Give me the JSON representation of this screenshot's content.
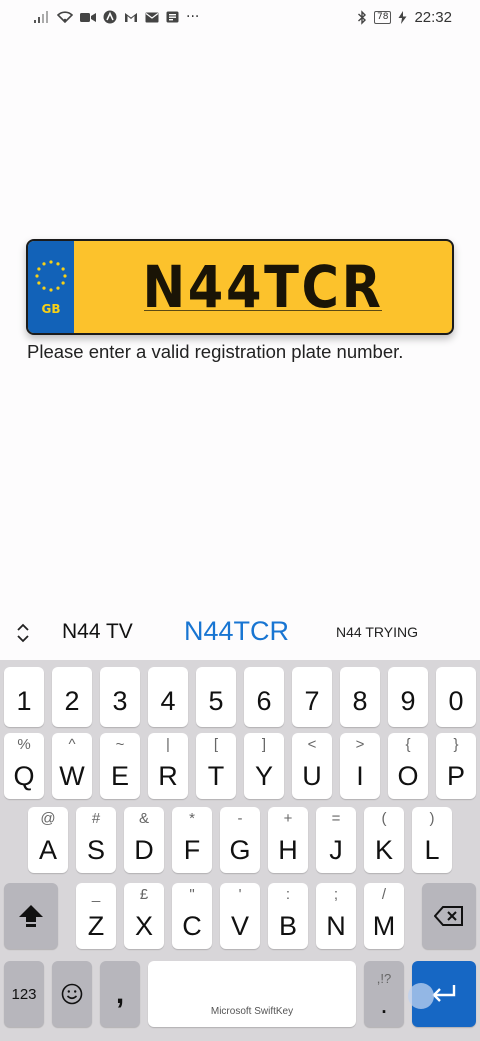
{
  "status_bar": {
    "time": "22:32",
    "battery": "78",
    "left_icons": [
      "signal-icon",
      "wifi-icon",
      "video-icon",
      "arch-icon",
      "gmail-icon",
      "mail-icon",
      "news-icon",
      "more-icon"
    ],
    "more_label": "···"
  },
  "plate": {
    "country": "GB",
    "registration": "N44TCR"
  },
  "hint_text": "Please enter a valid registration plate number.",
  "suggestions": [
    "N44 TV",
    "N44TCR",
    "N44 TRYING"
  ],
  "keyboard": {
    "numbers": [
      "1",
      "2",
      "3",
      "4",
      "5",
      "6",
      "7",
      "8",
      "9",
      "0"
    ],
    "row1": [
      {
        "main": "Q",
        "sub": "%"
      },
      {
        "main": "W",
        "sub": "^"
      },
      {
        "main": "E",
        "sub": "~"
      },
      {
        "main": "R",
        "sub": "|"
      },
      {
        "main": "T",
        "sub": "["
      },
      {
        "main": "Y",
        "sub": "]"
      },
      {
        "main": "U",
        "sub": "<"
      },
      {
        "main": "I",
        "sub": ">"
      },
      {
        "main": "O",
        "sub": "{"
      },
      {
        "main": "P",
        "sub": "}"
      }
    ],
    "row2": [
      {
        "main": "A",
        "sub": "@"
      },
      {
        "main": "S",
        "sub": "#"
      },
      {
        "main": "D",
        "sub": "&"
      },
      {
        "main": "F",
        "sub": "*"
      },
      {
        "main": "G",
        "sub": "-"
      },
      {
        "main": "H",
        "sub": "+"
      },
      {
        "main": "J",
        "sub": "="
      },
      {
        "main": "K",
        "sub": "("
      },
      {
        "main": "L",
        "sub": ")"
      }
    ],
    "row3": [
      {
        "main": "Z",
        "sub": "_"
      },
      {
        "main": "X",
        "sub": "£"
      },
      {
        "main": "C",
        "sub": "\""
      },
      {
        "main": "V",
        "sub": "'"
      },
      {
        "main": "B",
        "sub": ":"
      },
      {
        "main": "N",
        "sub": ";"
      },
      {
        "main": "M",
        "sub": "/"
      }
    ],
    "num_mode_label": "123",
    "comma_label": ",",
    "space_label": "Microsoft SwiftKey",
    "period_label": ".",
    "period_sub": ",!?"
  },
  "colors": {
    "plate_yellow": "#fcc22c",
    "plate_band_blue": "#1262b8",
    "suggestion_accent": "#1875d2",
    "enter_key": "#1667c4",
    "keyboard_bg": "#d8d6d9"
  }
}
